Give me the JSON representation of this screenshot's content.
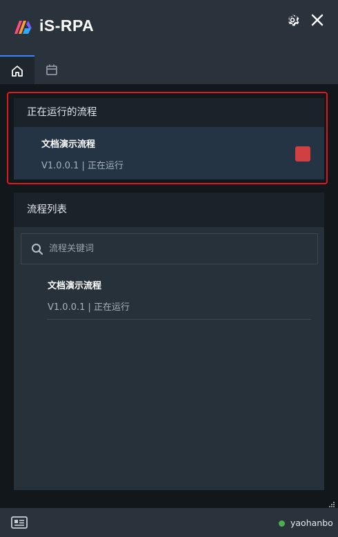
{
  "app": {
    "title": "iS-RPA"
  },
  "tabs": [
    {
      "icon": "home-icon",
      "active": true
    },
    {
      "icon": "calendar-icon",
      "active": false
    }
  ],
  "running_panel": {
    "title": "正在运行的流程",
    "items": [
      {
        "name": "文档演示流程",
        "version": "V1.0.0.1 | 正在运行"
      }
    ]
  },
  "list_panel": {
    "title": "流程列表",
    "search": {
      "placeholder": "流程关键词",
      "value": ""
    },
    "items": [
      {
        "name": "文档演示流程",
        "version": "V1.0.0.1 | 正在运行"
      }
    ]
  },
  "status": {
    "username": "yaohanbo",
    "online_color": "#4caf50"
  },
  "colors": {
    "accent": "#3a86ff",
    "stop": "#d14040",
    "highlight": "#e0171c"
  }
}
